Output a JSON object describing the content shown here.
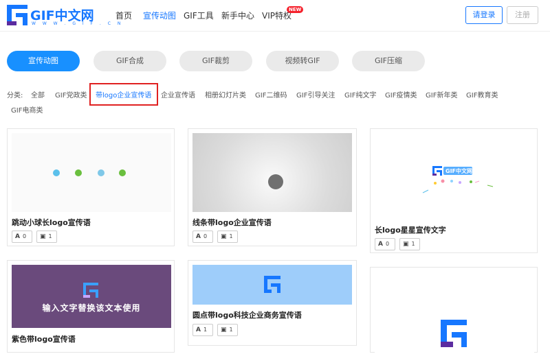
{
  "brand": {
    "name": "GIF中文网",
    "url_text": "W W W . G I F . C N",
    "accent": "#1677ff"
  },
  "nav": {
    "items": [
      {
        "label": "首页"
      },
      {
        "label": "宣传动图"
      },
      {
        "label": "GIF工具"
      },
      {
        "label": "新手中心"
      },
      {
        "label": "VIP特权"
      }
    ],
    "vip_badge": "NEW",
    "login_label": "请登录",
    "register_label": "注册"
  },
  "tabs": [
    {
      "label": "宣传动图"
    },
    {
      "label": "GIF合成"
    },
    {
      "label": "GIF裁剪"
    },
    {
      "label": "视频转GIF"
    },
    {
      "label": "GIF压缩"
    }
  ],
  "categories": {
    "prefix": "分类:",
    "items": [
      {
        "label": "全部"
      },
      {
        "label": "GIF党政类"
      },
      {
        "label": "带logo企业宣传语"
      },
      {
        "label": "企业宣传语"
      },
      {
        "label": "相册幻灯片类"
      },
      {
        "label": "GIF二维码"
      },
      {
        "label": "GIF引导关注"
      },
      {
        "label": "GIF纯文字"
      },
      {
        "label": "GIF疫情类"
      },
      {
        "label": "GIF新年类"
      },
      {
        "label": "GIF教育类"
      },
      {
        "label": "GIF电商类"
      }
    ]
  },
  "cards": [
    {
      "title": "跳动小球长logo宣传语",
      "text_count": "0",
      "image_count": "1"
    },
    {
      "title": "线条带logo企业宣传语",
      "text_count": "0",
      "image_count": "1"
    },
    {
      "title": "长logo星星宣传文字",
      "text_count": "0",
      "image_count": "1"
    },
    {
      "title": "紫色带logo宣传语",
      "overlay_text": "输入文字替换该文本使用"
    },
    {
      "title": "圆点带logo科技企业商务宣传语",
      "text_count": "1",
      "image_count": "1"
    },
    {
      "title": ""
    }
  ],
  "card3_logo_text": "GIF中文网"
}
